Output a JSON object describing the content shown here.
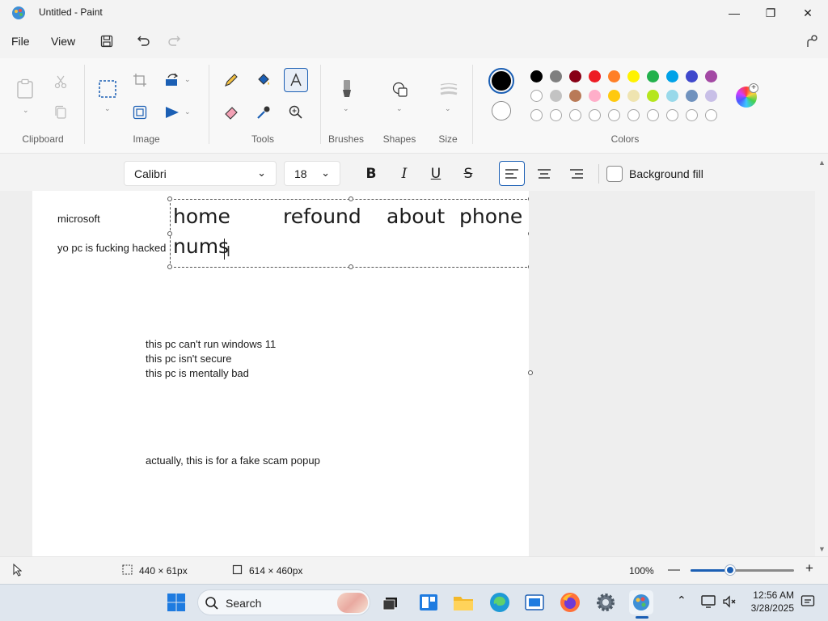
{
  "window": {
    "title": "Untitled - Paint",
    "controls": {
      "minimize": "—",
      "maximize": "❐",
      "close": "✕"
    }
  },
  "menu": {
    "file": "File",
    "view": "View"
  },
  "ribbon": {
    "groups": {
      "clipboard": "Clipboard",
      "image": "Image",
      "tools": "Tools",
      "brushes": "Brushes",
      "shapes": "Shapes",
      "size": "Size",
      "colors": "Colors"
    },
    "palette_row1": [
      "#000000",
      "#7f7f7f",
      "#880015",
      "#ed1c24",
      "#ff7f27",
      "#fff200",
      "#22b14c",
      "#00a2e8",
      "#3f48cc",
      "#a349a4"
    ],
    "palette_row2": [
      "#ffffff",
      "#c3c3c3",
      "#b97a57",
      "#ffaec9",
      "#ffc90e",
      "#efe4b0",
      "#b5e61d",
      "#99d9ea",
      "#7092be",
      "#c8bfe7"
    ],
    "palette_row3_count_label": ""
  },
  "format": {
    "font": "Calibri",
    "size": "18",
    "background_fill": "Background fill"
  },
  "canvas": {
    "texts": {
      "microsoft": "microsoft",
      "hacked": "yo pc is fucking hacked",
      "line1": "this pc can't run windows 11",
      "line2": "this pc isn't secure",
      "line3": "this pc is mentally bad",
      "footer": "actually, this is for a fake scam popup"
    },
    "textbox": {
      "home": "home",
      "refound": "refound",
      "about": "about",
      "phone": "phone",
      "nums": "nums"
    }
  },
  "status": {
    "selection_size": "440 × 61px",
    "canvas_size": "614 × 460px",
    "zoom": "100%"
  },
  "taskbar": {
    "search_label": "Search",
    "time": "12:56 AM",
    "date": "3/28/2025"
  },
  "colors": {
    "accent": "#1b5fb4",
    "primary_color": "#000000",
    "secondary_color": "#ffffff"
  }
}
